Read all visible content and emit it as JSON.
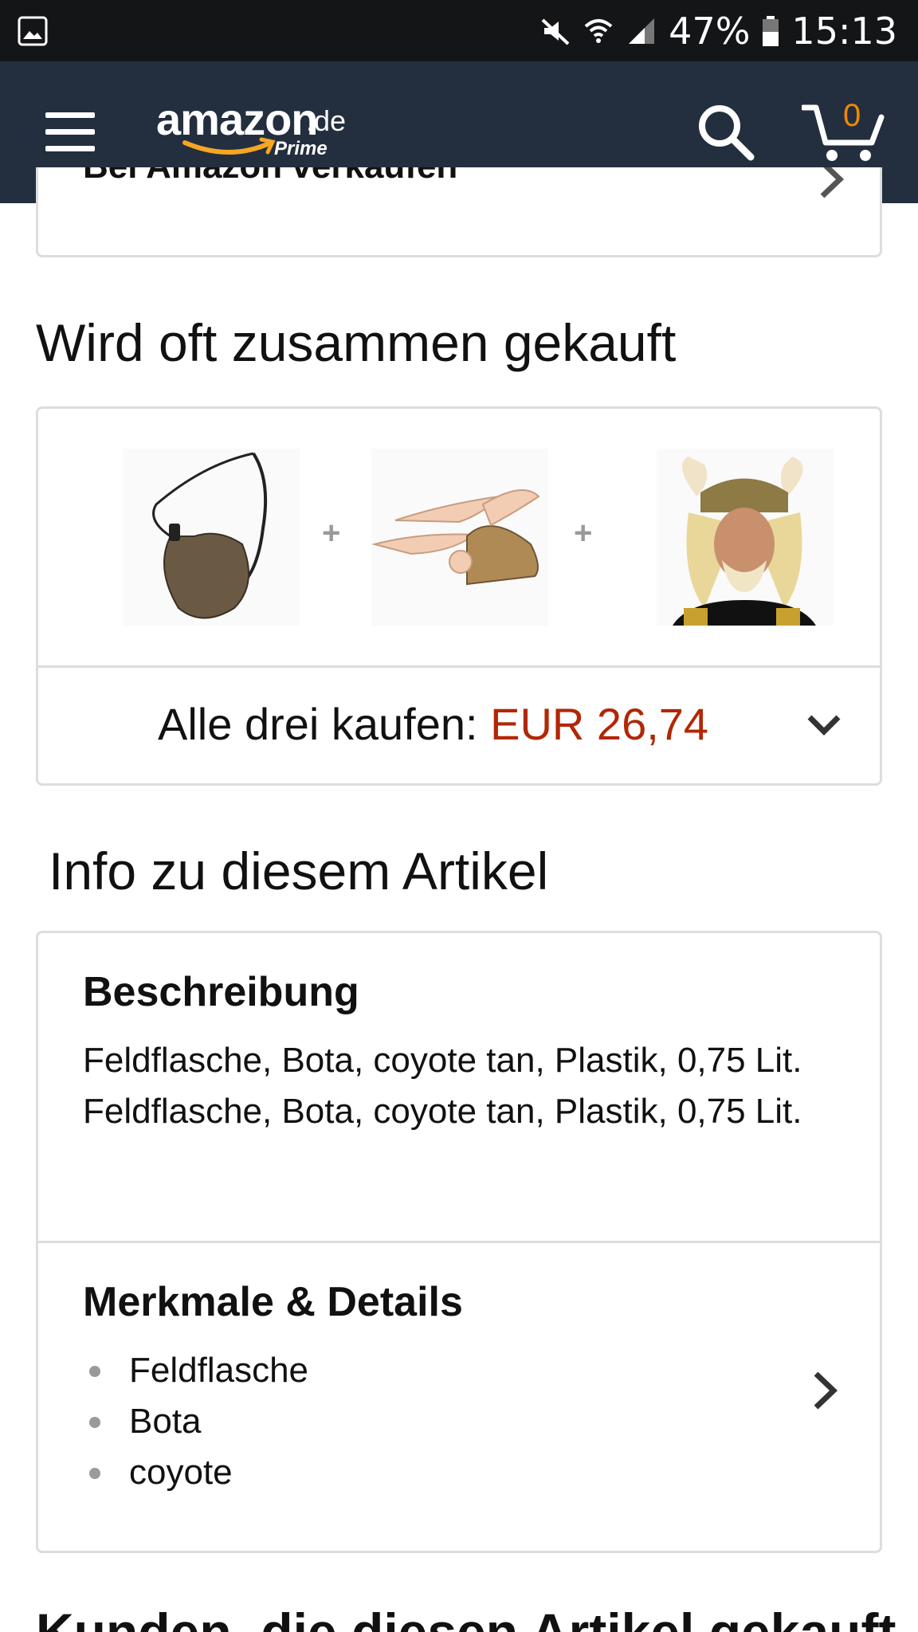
{
  "status_bar": {
    "battery": "47%",
    "time": "15:13"
  },
  "header": {
    "logo_text": "amazon",
    "logo_tld": ".de",
    "logo_sub": "Prime",
    "cart_count": "0"
  },
  "sell_row": {
    "label": "Bei Amazon verkaufen"
  },
  "fbt": {
    "title": "Wird oft zusammen gekauft",
    "products": [
      {
        "name": "canteen-bota",
        "icon": "bota-bag"
      },
      {
        "name": "winged-helmet",
        "icon": "winged-helmet"
      },
      {
        "name": "viking-costume-wig",
        "icon": "viking-wig"
      }
    ],
    "plus_sign": "+",
    "buy_label": "Alle drei kaufen: ",
    "buy_price": "EUR 26,74"
  },
  "info": {
    "title": "Info zu diesem Artikel",
    "description_heading": "Beschreibung",
    "description_text": "Feldflasche, Bota, coyote tan, Plastik, 0,75 Lit. Feldflasche, Bota, coyote tan, Plastik, 0,75 Lit.",
    "details_heading": "Merkmale & Details",
    "bullets": [
      "Feldflasche",
      "Bota",
      "coyote"
    ]
  },
  "next_section": {
    "title": "Kunden, die diesen Artikel gekauft"
  },
  "colors": {
    "header_bg": "#232f3e",
    "status_bg": "#141517",
    "price": "#b12704",
    "cart_count": "#f08804",
    "smile": "#f6a623"
  }
}
